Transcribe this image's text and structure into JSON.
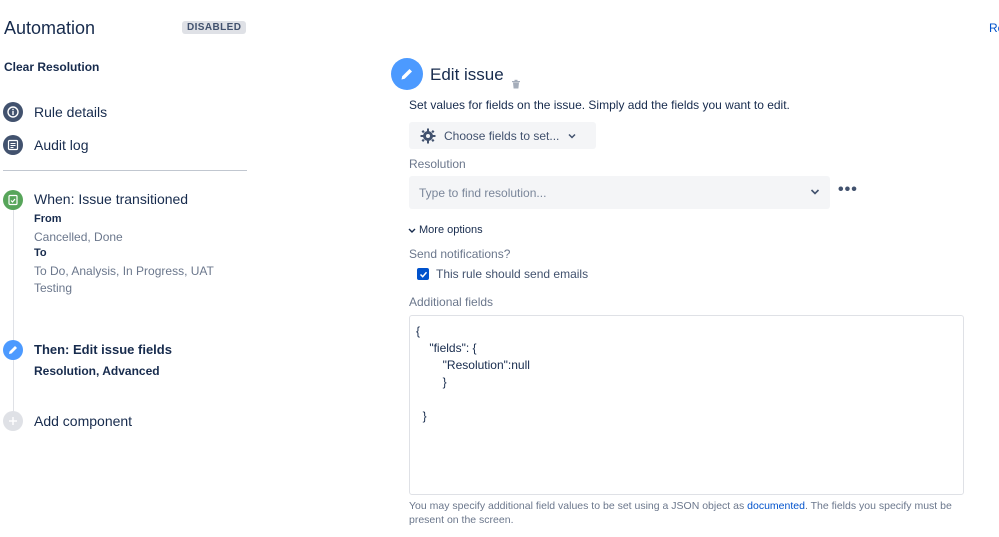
{
  "header": {
    "title": "Automation",
    "status_badge": "DISABLED",
    "top_right_link": "Re"
  },
  "rule": {
    "name": "Clear Resolution"
  },
  "sidebar": {
    "nav": [
      {
        "label": "Rule details",
        "icon": "info-icon"
      },
      {
        "label": "Audit log",
        "icon": "list-icon"
      }
    ],
    "trigger": {
      "title": "When: Issue transitioned",
      "from_label": "From",
      "from_value": "Cancelled, Done",
      "to_label": "To",
      "to_value": "To Do, Analysis, In Progress, UAT Testing"
    },
    "action": {
      "title": "Then: Edit issue fields",
      "details": "Resolution, Advanced"
    },
    "add_component": "Add component"
  },
  "editor": {
    "title": "Edit issue",
    "description": "Set values for fields on the issue. Simply add the fields you want to edit.",
    "choose_fields": "Choose fields to set...",
    "resolution_label": "Resolution",
    "resolution_placeholder": "Type to find resolution...",
    "more_options": "More options",
    "send_notifications_label": "Send notifications?",
    "send_emails_checkbox": "This rule should send emails",
    "additional_fields_label": "Additional fields",
    "additional_fields_value": "{\n    \"fields\": {\n        \"Resolution\":null\n        }\n\n  }",
    "help_text_before": "You may specify additional field values to be set using a JSON object as ",
    "help_link": "documented",
    "help_text_after": ". The fields you specify must be present on the screen."
  },
  "colors": {
    "trigger_green": "#57a55a",
    "action_blue": "#4c9aff",
    "nav_icon": "#42526e",
    "link_blue": "#0052cc"
  }
}
